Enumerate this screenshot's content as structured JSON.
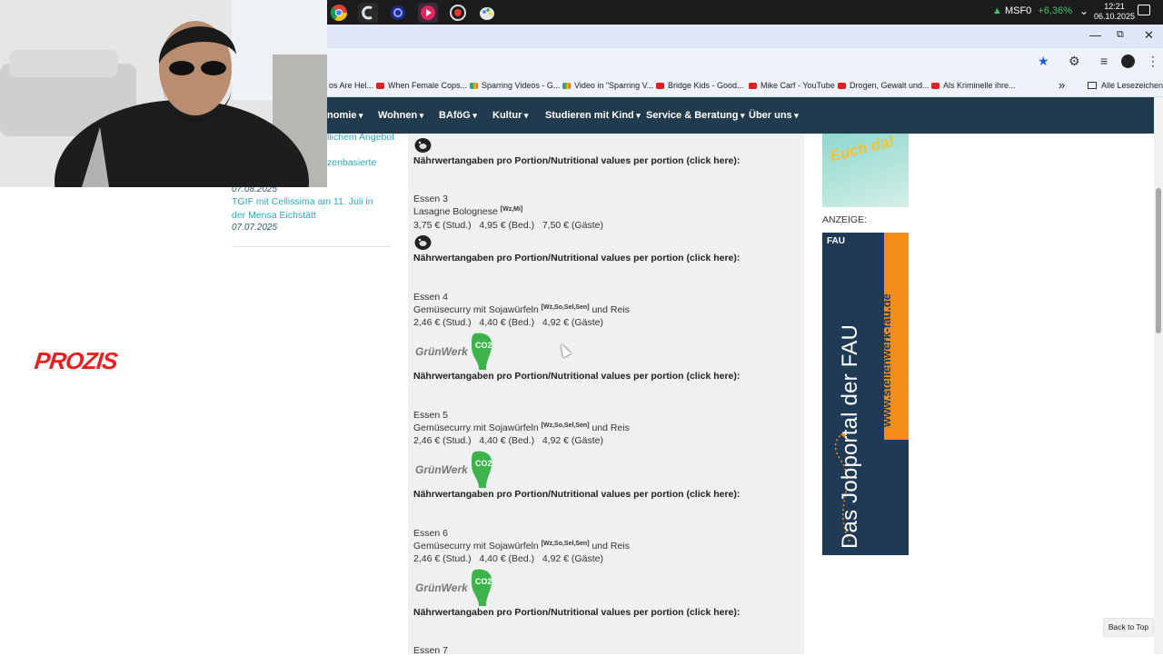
{
  "taskbar": {
    "stock_ticker": "MSF0",
    "stock_change": "+6,36%",
    "time": "12:21",
    "date": "06.10.2025"
  },
  "bookmarks": {
    "items": [
      {
        "label": "os Are Hel..."
      },
      {
        "label": "When Female Cops..."
      },
      {
        "label": "Sparring Videos - G..."
      },
      {
        "label": "Video in \"Sparring V..."
      },
      {
        "label": "Bridge Kids - Good..."
      },
      {
        "label": "Mike Carf - YouTube"
      },
      {
        "label": "Drogen, Gewalt und..."
      },
      {
        "label": "Als Kriminelle ihre..."
      }
    ],
    "more": "»",
    "all_bookmarks": "Alle Lesezeichen"
  },
  "nav": {
    "items": [
      {
        "label": "nomie"
      },
      {
        "label": "Wohnen"
      },
      {
        "label": "BAföG"
      },
      {
        "label": "Kultur"
      },
      {
        "label": "Studieren mit Kind"
      },
      {
        "label": "Service & Beratung"
      },
      {
        "label": "Über uns"
      }
    ]
  },
  "sidebar": {
    "fragment_1": "llichem Angebot",
    "fragment_2": "zenbasierte",
    "date_1": "07.08.2025",
    "news_title": "TGIF mit Cellissima am 11. Juli in der Mensa Eichstätt",
    "date_2": "07.07.2025",
    "ad_brand": "PROZIS"
  },
  "menu": {
    "nutri_label": "Nährwertangaben pro Portion/Nutritional values per portion (click here):",
    "meals": [
      {
        "title": "Essen 3",
        "name": "Lasagne Bolognese",
        "allergens": "[Wz,Mi]",
        "suffix": "",
        "price": "3,75 € (Stud.)   4,95 € (Bed.)   7,50 € (Gäste)"
      },
      {
        "title": "Essen 4",
        "name": "Gemüsecurry mit Sojawürfeln",
        "allergens": "[Wz,So,Sel,Sen]",
        "suffix": "und Reis",
        "price": "2,46 € (Stud.)   4,40 € (Bed.)   4,92 € (Gäste)"
      },
      {
        "title": "Essen 5",
        "name": "Gemüsecurry mit Sojawürfeln",
        "allergens": "[Wz,So,Sel,Sen]",
        "suffix": "und Reis",
        "price": "2,46 € (Stud.)   4,40 € (Bed.)   4,92 € (Gäste)"
      },
      {
        "title": "Essen 6",
        "name": "Gemüsecurry mit Sojawürfeln",
        "allergens": "[Wz,So,Sel,Sen]",
        "suffix": "und Reis",
        "price": "2,46 € (Stud.)   4,40 € (Bed.)   4,92 € (Gäste)"
      },
      {
        "title": "Essen 7"
      }
    ],
    "gruenwerk_logo": "GrünWerk",
    "co2": "CO2"
  },
  "right": {
    "ad_top_text": "Euch da!",
    "ad_label": "ANZEIGE:",
    "jobad_brand": "FAU",
    "jobad_url": "www.stellenwerk-fau.de",
    "jobad_main": "Das Jobportal der FAU"
  },
  "back_to_top": "Back to Top",
  "colors": {
    "nav_bg": "#203a4e",
    "link": "#2aa8b8",
    "gruen": "#3cb44a",
    "prozis": "#e8201f"
  }
}
